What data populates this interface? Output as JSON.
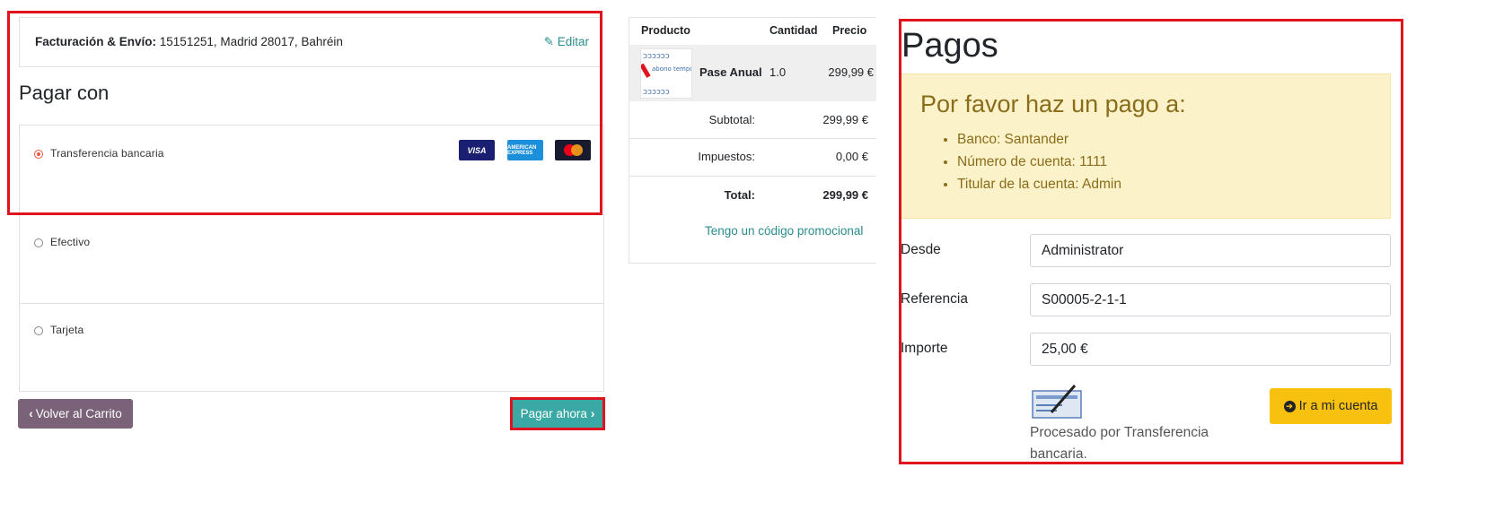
{
  "left_panel": {
    "billing": {
      "label": "Facturación & Envío:",
      "value": " 15151251, Madrid 28017, Bahréin",
      "edit_label": "Editar"
    },
    "pay_with_title": "Pagar con",
    "payment_methods": [
      {
        "label": "Transferencia bancaria",
        "selected": true
      },
      {
        "label": "Efectivo",
        "selected": false
      },
      {
        "label": "Tarjeta",
        "selected": false
      }
    ],
    "card_icons": [
      "visa-icon",
      "amex-icon",
      "mastercard-icon"
    ],
    "card_icon_text": {
      "visa": "VISA",
      "amex": "AMERICAN EXPRESS"
    },
    "back_button": "Volver al Carrito",
    "pay_button": "Pagar ahora"
  },
  "order_summary": {
    "headers": {
      "product": "Producto",
      "quantity": "Cantidad",
      "price": "Precio"
    },
    "item": {
      "name": "Pase Anual",
      "quantity": "1.0",
      "price": "299,99 €",
      "thumb_text": "abono temporada"
    },
    "subtotal_label": "Subtotal:",
    "subtotal_value": "299,99 €",
    "taxes_label": "Impuestos:",
    "taxes_value": "0,00 €",
    "total_label": "Total:",
    "total_value": "299,99 €",
    "promo_link": "Tengo un código promocional"
  },
  "payments": {
    "title": "Pagos",
    "alert_heading": "Por favor haz un pago a:",
    "alert_items": [
      "Banco: Santander",
      "Número de cuenta: 1111",
      "Titular de la cuenta: Admin"
    ],
    "fields": [
      {
        "label": "Desde",
        "value": "Administrator"
      },
      {
        "label": "Referencia",
        "value": "S00005-2-1-1"
      },
      {
        "label": "Importe",
        "value": "25,00 €"
      }
    ],
    "processed_text": "Procesado por Transferencia bancaria.",
    "account_button": "Ir a mi cuenta"
  },
  "colors": {
    "highlight": "#e0141e",
    "teal": "#3aa9a5",
    "mauve": "#7a6278",
    "warning": "#f8c00f",
    "alert_bg": "#fcf2c9"
  }
}
